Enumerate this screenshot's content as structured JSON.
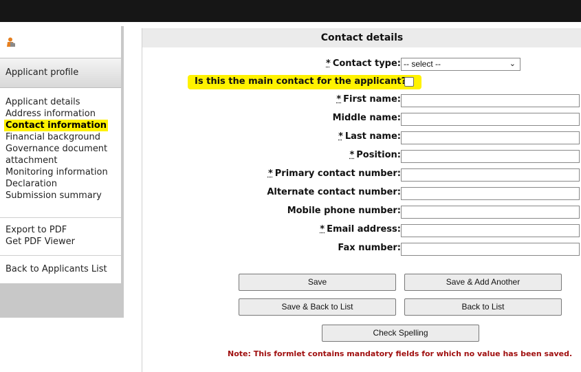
{
  "sidebar": {
    "profile_label": "Applicant profile",
    "items": [
      {
        "label": "Applicant details",
        "active": false
      },
      {
        "label": "Address information",
        "active": false
      },
      {
        "label": "Contact information",
        "active": true
      },
      {
        "label": "Financial background",
        "active": false
      },
      {
        "label": "Governance document attachment",
        "active": false
      },
      {
        "label": "Monitoring information",
        "active": false
      },
      {
        "label": "Declaration",
        "active": false
      },
      {
        "label": "Submission summary",
        "active": false
      }
    ],
    "export_pdf": "Export to PDF",
    "get_viewer": "Get PDF Viewer",
    "back_to_list": "Back to Applicants List"
  },
  "form": {
    "title": "Contact details",
    "required_marker": "*",
    "contact_type_label": "Contact type:",
    "contact_type_value": "-- select --",
    "main_contact_label": "Is this the main contact for the applicant?",
    "fields": {
      "first_name": {
        "label": "First name:",
        "value": ""
      },
      "middle_name": {
        "label": "Middle name:",
        "value": ""
      },
      "last_name": {
        "label": "Last name:",
        "value": ""
      },
      "position": {
        "label": "Position:",
        "value": ""
      },
      "primary_contact": {
        "label": "Primary contact number:",
        "value": ""
      },
      "alternate_contact": {
        "label": "Alternate contact number:",
        "value": ""
      },
      "mobile_phone": {
        "label": "Mobile phone number:",
        "value": ""
      },
      "email": {
        "label": "Email address:",
        "value": ""
      },
      "fax": {
        "label": "Fax number:",
        "value": ""
      }
    }
  },
  "buttons": {
    "save": "Save",
    "save_add_another": "Save & Add Another",
    "save_back": "Save & Back to List",
    "back_to_list": "Back to List",
    "check_spelling": "Check Spelling"
  },
  "note": "Note: This formlet contains mandatory fields for which no value has been saved.",
  "colors": {
    "highlight": "#fff200",
    "note_text": "#a01010",
    "topbar": "#161616"
  },
  "icons": {
    "logo": "user-logo-icon",
    "dropdown": "chevron-down-icon"
  }
}
